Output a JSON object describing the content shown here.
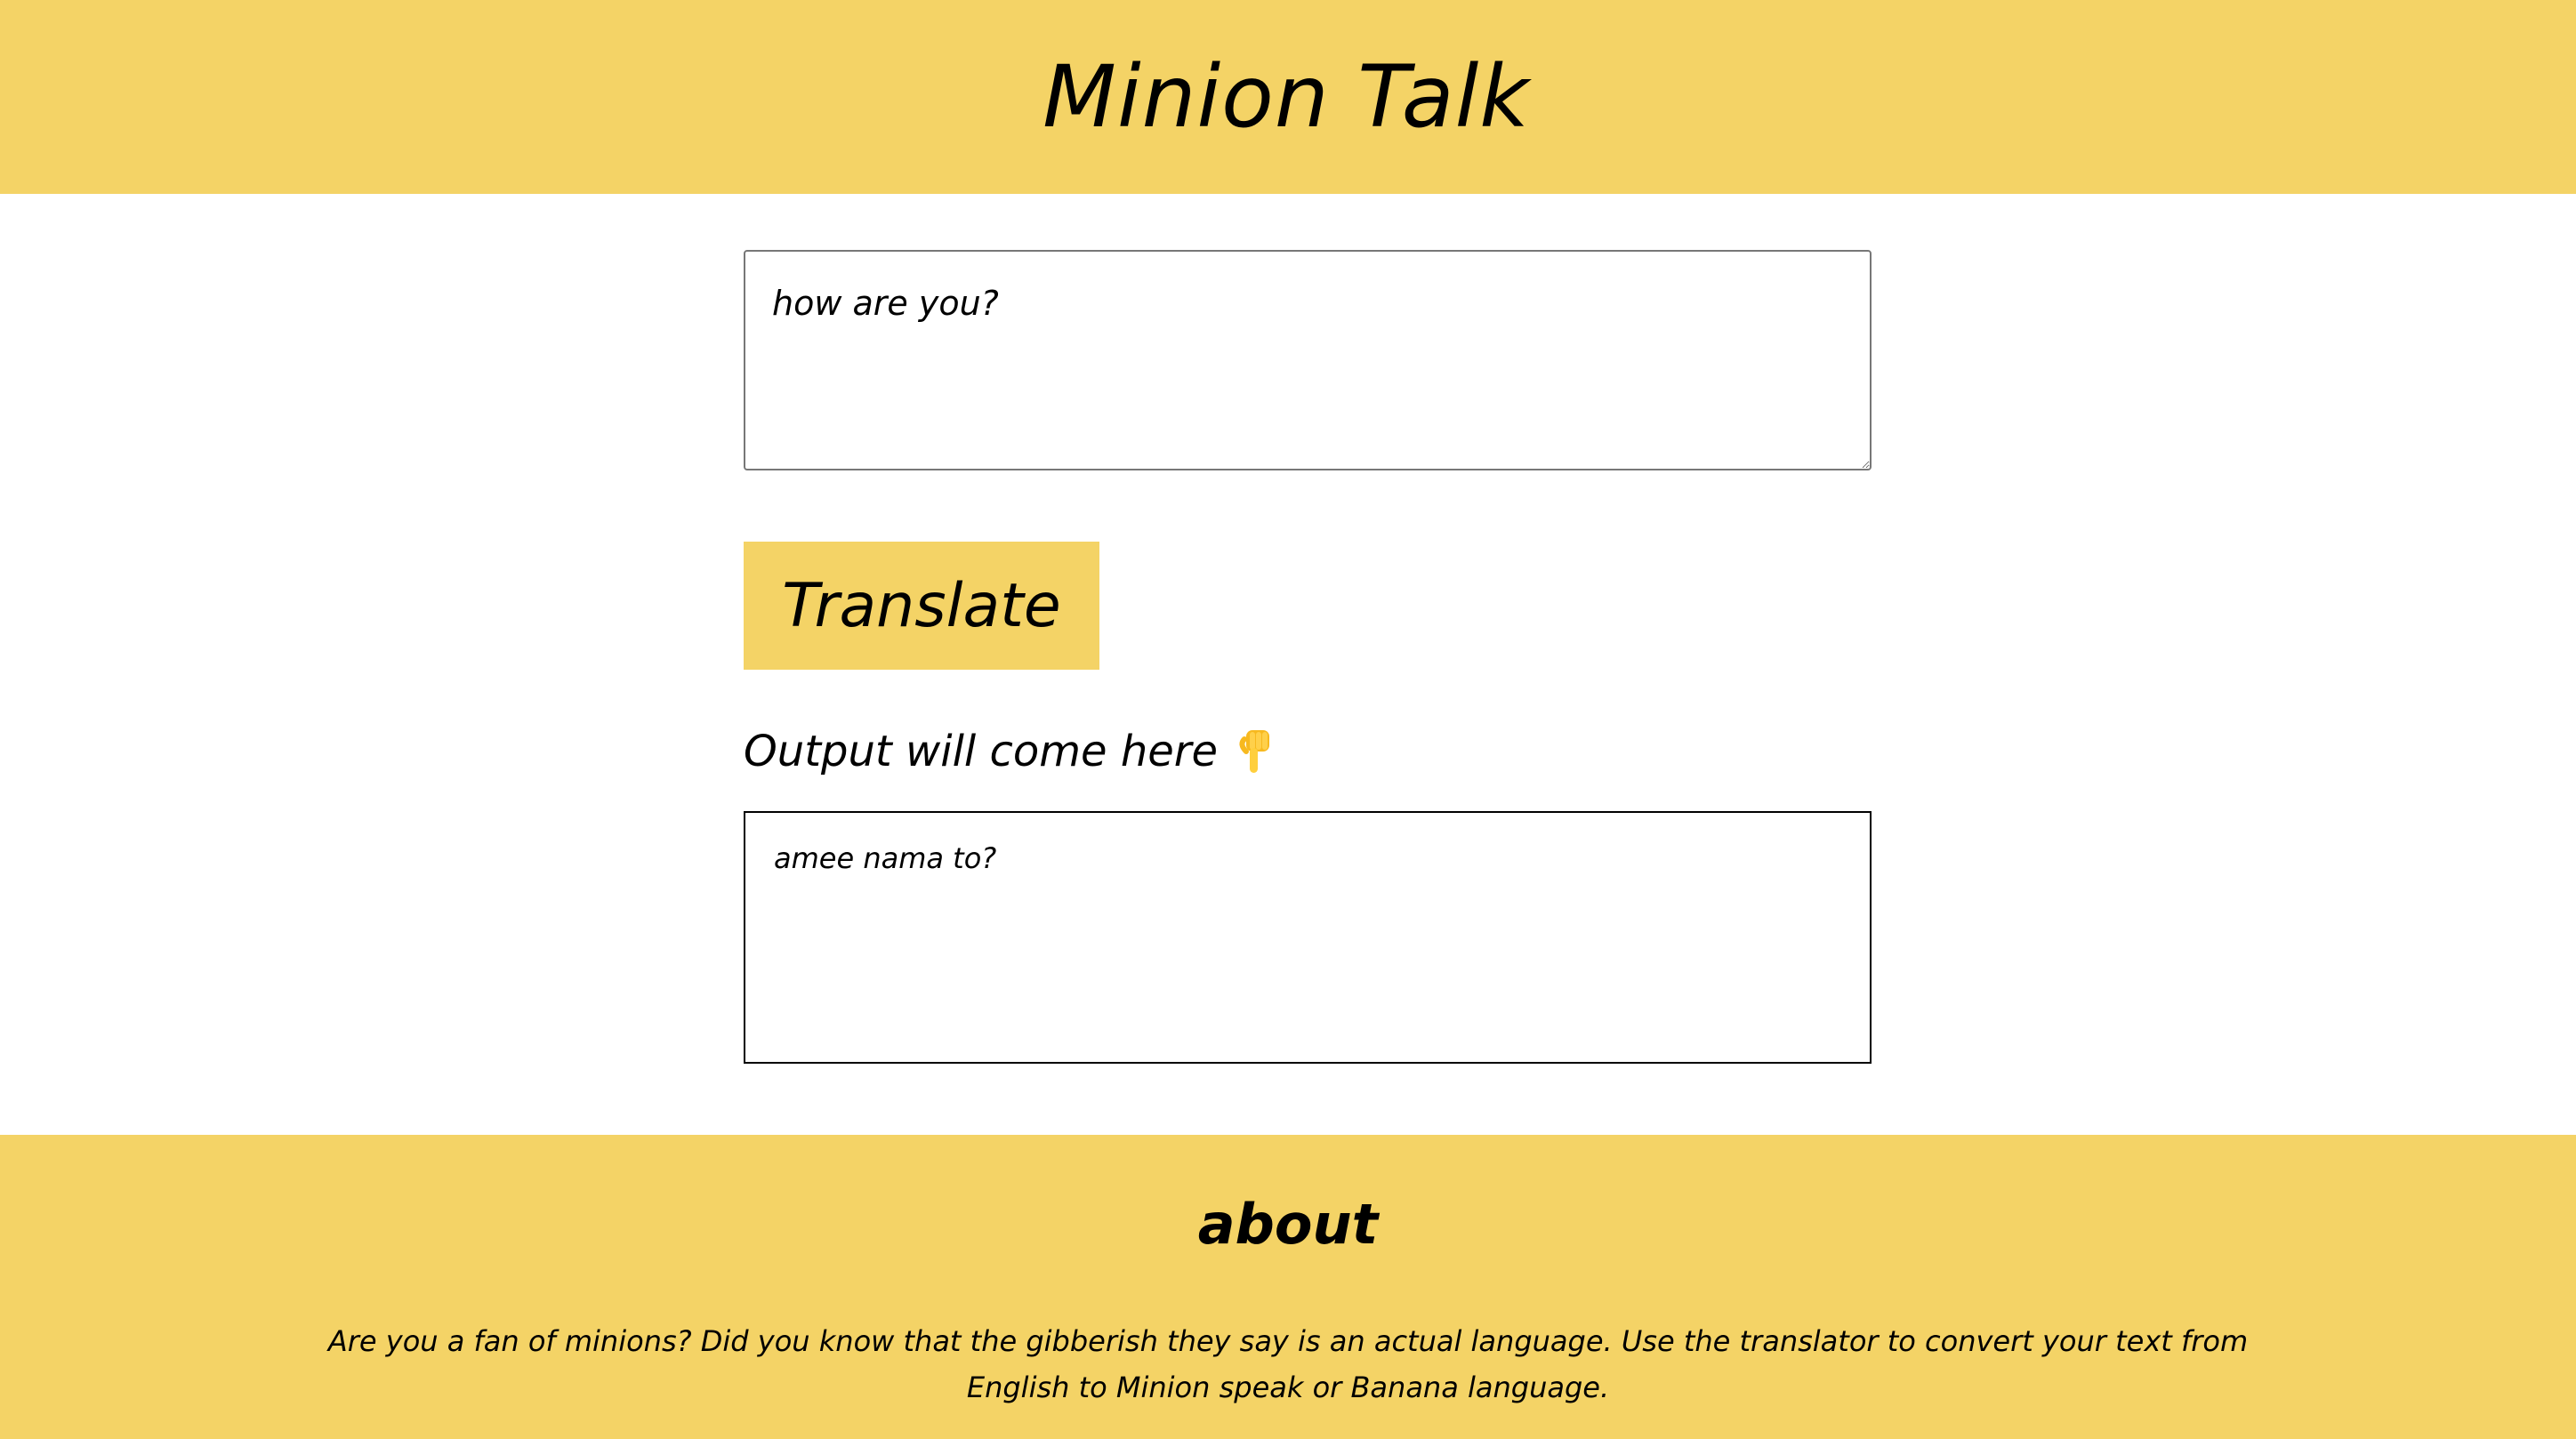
{
  "header": {
    "title": "Minion Talk"
  },
  "translator": {
    "input_value": "how are you?",
    "button_label": "Translate",
    "output_label": "Output will come here",
    "output_value": "amee nama to?"
  },
  "footer": {
    "heading": "about",
    "description": "Are you a fan of minions? Did you know that the gibberish they say is an actual language. Use the translator to convert your text from English to Minion speak or Banana language."
  },
  "icons": {
    "output_icon": "pointing-down-hand-icon"
  },
  "colors": {
    "accent": "#f4d366",
    "background": "#ffffff",
    "text": "#000000"
  }
}
